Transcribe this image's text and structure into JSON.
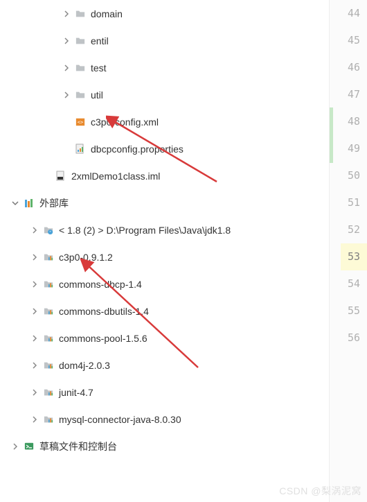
{
  "tree": {
    "rows": [
      {
        "indent": 88,
        "expandable": true,
        "expanded": false,
        "icon": "folder",
        "label": "domain"
      },
      {
        "indent": 88,
        "expandable": true,
        "expanded": false,
        "icon": "folder",
        "label": "entil"
      },
      {
        "indent": 88,
        "expandable": true,
        "expanded": false,
        "icon": "folder",
        "label": "test"
      },
      {
        "indent": 88,
        "expandable": true,
        "expanded": false,
        "icon": "folder",
        "label": "util"
      },
      {
        "indent": 88,
        "expandable": false,
        "icon": "xml",
        "label": "c3p0-config.xml"
      },
      {
        "indent": 88,
        "expandable": false,
        "icon": "prop",
        "label": "dbcpconfig.properties"
      },
      {
        "indent": 60,
        "expandable": false,
        "icon": "iml",
        "label": "2xmlDemo1class.iml"
      },
      {
        "indent": 14,
        "expandable": true,
        "expanded": true,
        "icon": "lib",
        "label": "外部库"
      },
      {
        "indent": 42,
        "expandable": true,
        "expanded": false,
        "icon": "jdk",
        "label": "< 1.8 (2) >  D:\\Program Files\\Java\\jdk1.8"
      },
      {
        "indent": 42,
        "expandable": true,
        "expanded": false,
        "icon": "jar",
        "label": "c3p0-0.9.1.2"
      },
      {
        "indent": 42,
        "expandable": true,
        "expanded": false,
        "icon": "jar",
        "label": "commons-dbcp-1.4"
      },
      {
        "indent": 42,
        "expandable": true,
        "expanded": false,
        "icon": "jar",
        "label": "commons-dbutils-1.4"
      },
      {
        "indent": 42,
        "expandable": true,
        "expanded": false,
        "icon": "jar",
        "label": "commons-pool-1.5.6"
      },
      {
        "indent": 42,
        "expandable": true,
        "expanded": false,
        "icon": "jar",
        "label": "dom4j-2.0.3"
      },
      {
        "indent": 42,
        "expandable": true,
        "expanded": false,
        "icon": "jar",
        "label": "junit-4.7"
      },
      {
        "indent": 42,
        "expandable": true,
        "expanded": false,
        "icon": "jar",
        "label": "mysql-connector-java-8.0.30"
      },
      {
        "indent": 14,
        "expandable": true,
        "expanded": false,
        "icon": "console",
        "label": "草稿文件和控制台"
      }
    ]
  },
  "gutter": {
    "start": 44,
    "end": 56,
    "highlight": 53
  },
  "watermark": "CSDN @梨涡泥窝"
}
